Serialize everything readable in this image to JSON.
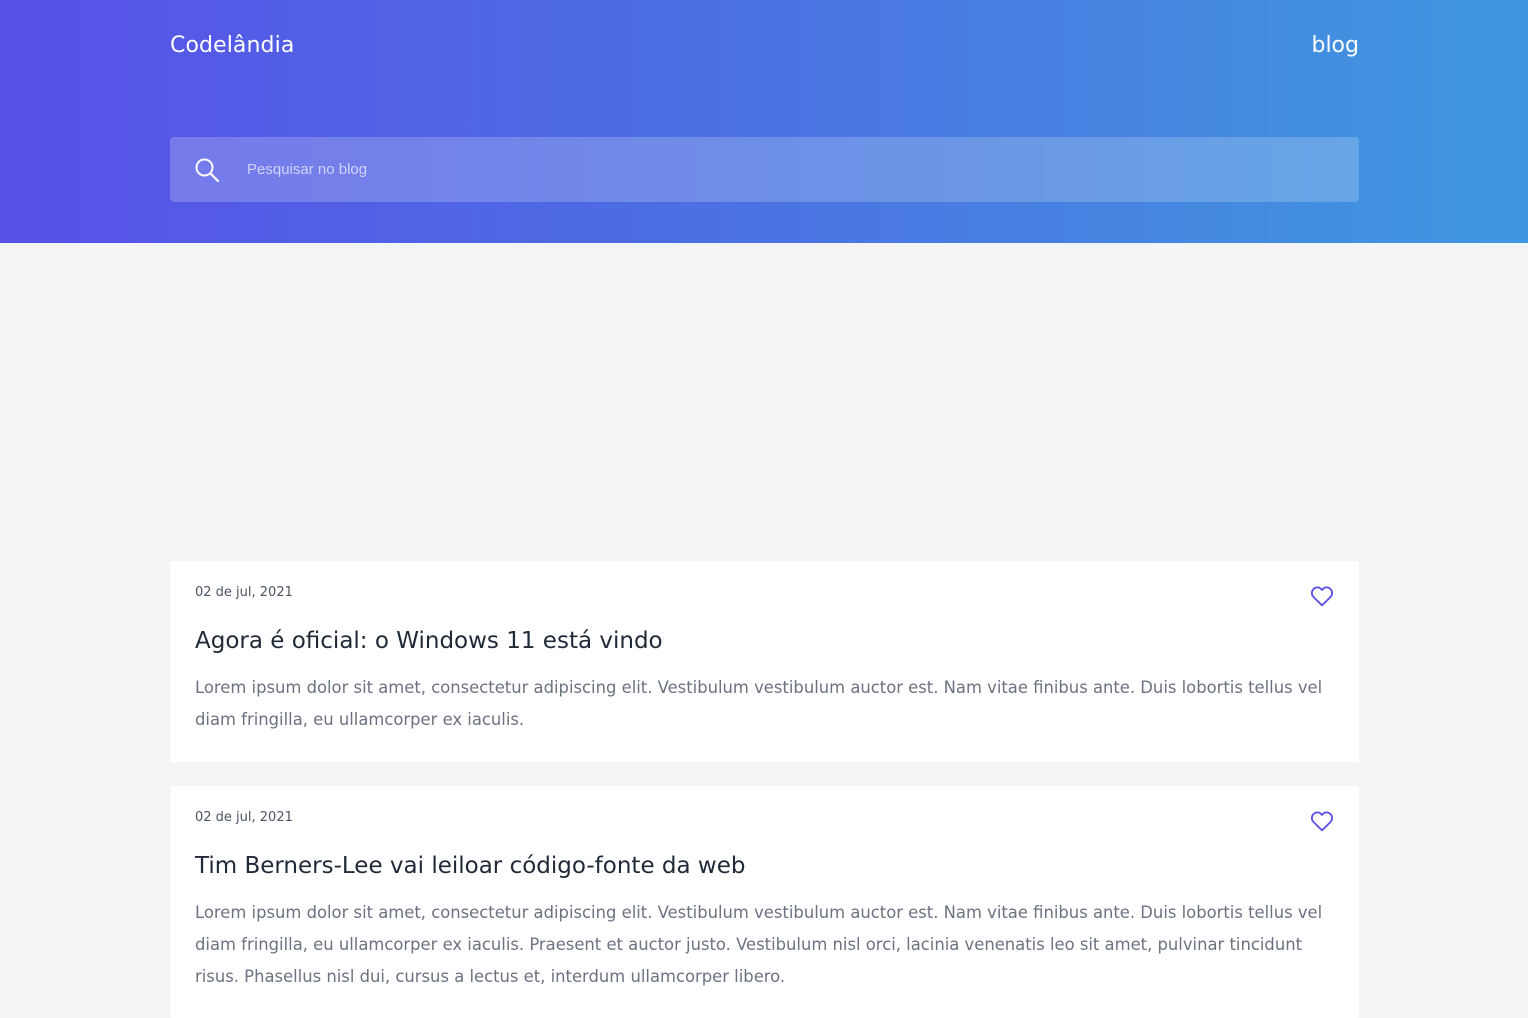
{
  "header": {
    "logo": "Codelândia",
    "nav_blog": "blog"
  },
  "search": {
    "placeholder": "Pesquisar no blog",
    "value": ""
  },
  "posts": [
    {
      "date": "02 de jul, 2021",
      "title": "Agora é oficial: o Windows 11 está vindo",
      "text": "Lorem ipsum dolor sit amet, consectetur adipiscing elit. Vestibulum vestibulum auctor est. Nam vitae finibus ante. Duis lobortis tellus vel diam fringilla, eu ullamcorper ex iaculis."
    },
    {
      "date": "02 de jul, 2021",
      "title": "Tim Berners-Lee vai leiloar código-fonte da web",
      "text": "Lorem ipsum dolor sit amet, consectetur adipiscing elit. Vestibulum vestibulum auctor est. Nam vitae finibus ante. Duis lobortis tellus vel diam fringilla, eu ullamcorper ex iaculis. Praesent et auctor justo. Vestibulum nisl orci, lacinia venenatis leo sit amet, pulvinar tincidunt risus. Phasellus nisl dui, cursus a lectus et, interdum ullamcorper libero."
    }
  ],
  "icons": {
    "search": "search-icon",
    "like": "heart-icon"
  },
  "colors": {
    "gradient_start": "#5751e8",
    "gradient_end": "#3f98df",
    "accent": "#5b4fe6",
    "background": "#f3f4f6"
  }
}
